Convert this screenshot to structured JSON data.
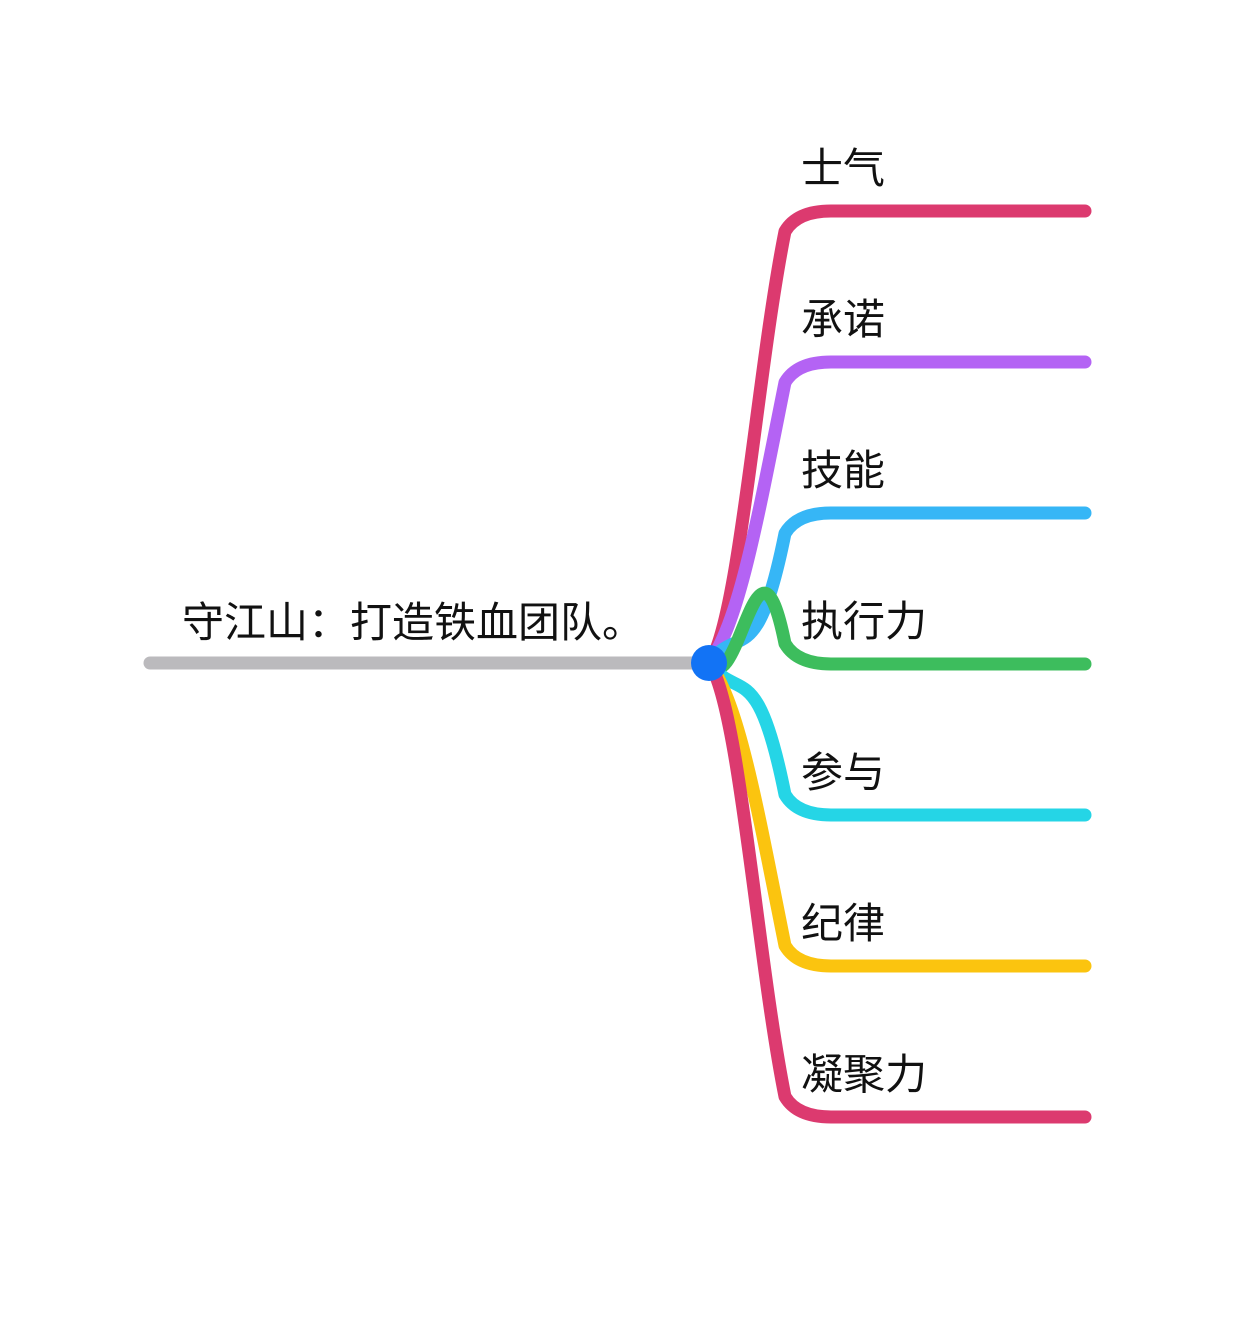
{
  "root": {
    "label": "守江山：打造铁血团队。",
    "line_color": "#bbbabd",
    "node_color": "#1273f5"
  },
  "branches": [
    {
      "label": "士气",
      "color": "#dc3a6f"
    },
    {
      "label": "承诺",
      "color": "#b463f4"
    },
    {
      "label": "技能",
      "color": "#36b6f6"
    },
    {
      "label": "执行力",
      "color": "#3dbd5d"
    },
    {
      "label": "参与",
      "color": "#25d5e6"
    },
    {
      "label": "纪律",
      "color": "#fbc40f"
    },
    {
      "label": "凝聚力",
      "color": "#dc3a6f"
    }
  ]
}
